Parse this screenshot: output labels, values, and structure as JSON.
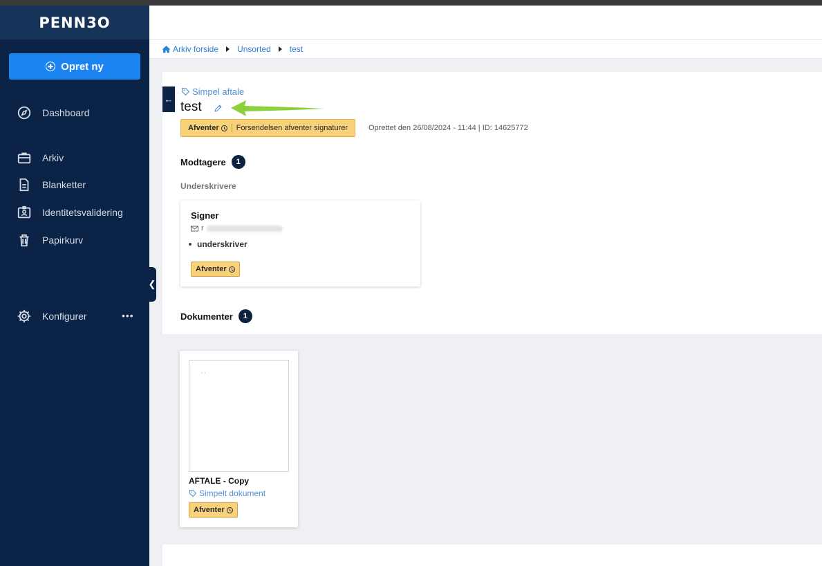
{
  "app": {
    "brand": "PENN3O"
  },
  "sidebar": {
    "create_button": "Opret ny",
    "items": [
      {
        "label": "Dashboard",
        "icon": "compass-icon"
      },
      {
        "label": "Arkiv",
        "icon": "briefcase-icon"
      },
      {
        "label": "Blanketter",
        "icon": "document-icon"
      },
      {
        "label": "Identitetsvalidering",
        "icon": "id-badge-icon"
      },
      {
        "label": "Papirkurv",
        "icon": "trash-icon"
      },
      {
        "label": "Konfigurer",
        "icon": "gear-icon"
      }
    ],
    "more": "•••"
  },
  "breadcrumb": {
    "items": [
      "Arkiv forside",
      "Unsorted",
      "test"
    ]
  },
  "case": {
    "type_tag": "Simpel aftale",
    "title": "test",
    "status_label": "Afventer",
    "status_text": "Forsendelsen afventer signaturer",
    "meta": "Oprettet den 26/08/2024 - 11:44 | ID: 14625772"
  },
  "recipients": {
    "heading": "Modtagere",
    "count": "1",
    "subheading": "Underskrivere",
    "signer": {
      "name": "Signer",
      "email_prefix": "r",
      "role": "underskriver",
      "status": "Afventer"
    }
  },
  "documents": {
    "heading": "Dokumenter",
    "count": "1",
    "items": [
      {
        "title": "AFTALE - Copy",
        "type": "Simpelt dokument",
        "status": "Afventer",
        "thumb_text": "` `"
      }
    ]
  },
  "colors": {
    "sidebar": "#0a2346",
    "primary": "#1c84f0",
    "status": "#f8d27a",
    "annotation_arrow": "#8cd13c"
  }
}
